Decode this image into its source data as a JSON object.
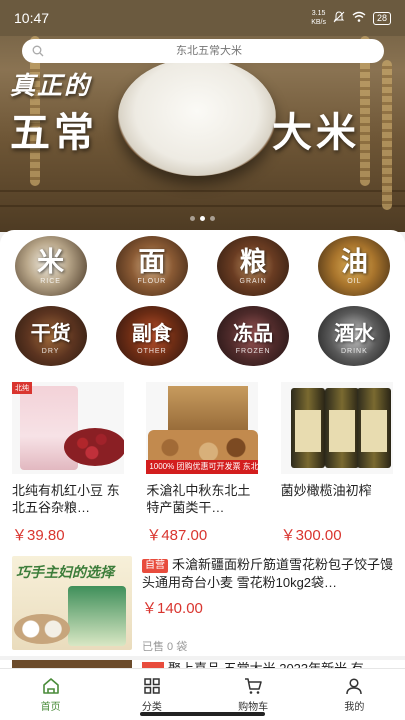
{
  "status": {
    "time": "10:47",
    "net_speed": "3.15",
    "net_unit": "KB/s",
    "battery": "28"
  },
  "search": {
    "placeholder": "东北五常大米"
  },
  "banner": {
    "line1": "真正的",
    "line2": "五常",
    "line3": "大米"
  },
  "categories": [
    {
      "cn": "米",
      "en": "RICE"
    },
    {
      "cn": "面",
      "en": "FLOUR"
    },
    {
      "cn": "粮",
      "en": "GRAIN"
    },
    {
      "cn": "油",
      "en": "OIL"
    },
    {
      "cn": "干货",
      "en": "DRY"
    },
    {
      "cn": "副食",
      "en": "OTHER"
    },
    {
      "cn": "冻品",
      "en": "FROZEN"
    },
    {
      "cn": "酒水",
      "en": "DRINK"
    }
  ],
  "products": [
    {
      "name": "北纯有机红小豆 东北五谷杂粮…",
      "price": "￥39.80",
      "badge": "北纯"
    },
    {
      "name": "禾滄礼中秋东北土特产菌类干…",
      "price": "￥487.00",
      "strip": "1000% 团购优惠可开发票 东北山珍 送礼佳品"
    },
    {
      "name": "菌妙橄榄油初榨",
      "price": "￥300.00"
    }
  ],
  "list_item": {
    "tag": "自营",
    "title": "禾滄新疆面粉斤筋道雪花粉包子饺子馒头通用奇台小麦 雪花粉10kg2袋…",
    "price": "￥140.00",
    "sold": "已售 0 袋",
    "thumb_text": "巧手主妇的选择"
  },
  "next_item": {
    "title": "聚上喜品 五常大米 2023年新米 有"
  },
  "tabs": [
    {
      "label": "首页",
      "icon": "home-icon"
    },
    {
      "label": "分类",
      "icon": "grid-icon"
    },
    {
      "label": "购物车",
      "icon": "cart-icon"
    },
    {
      "label": "我的",
      "icon": "user-icon"
    }
  ],
  "colors": {
    "accent": "#4a8c3a",
    "price": "#d9352f",
    "tag": "#e84c3d"
  }
}
